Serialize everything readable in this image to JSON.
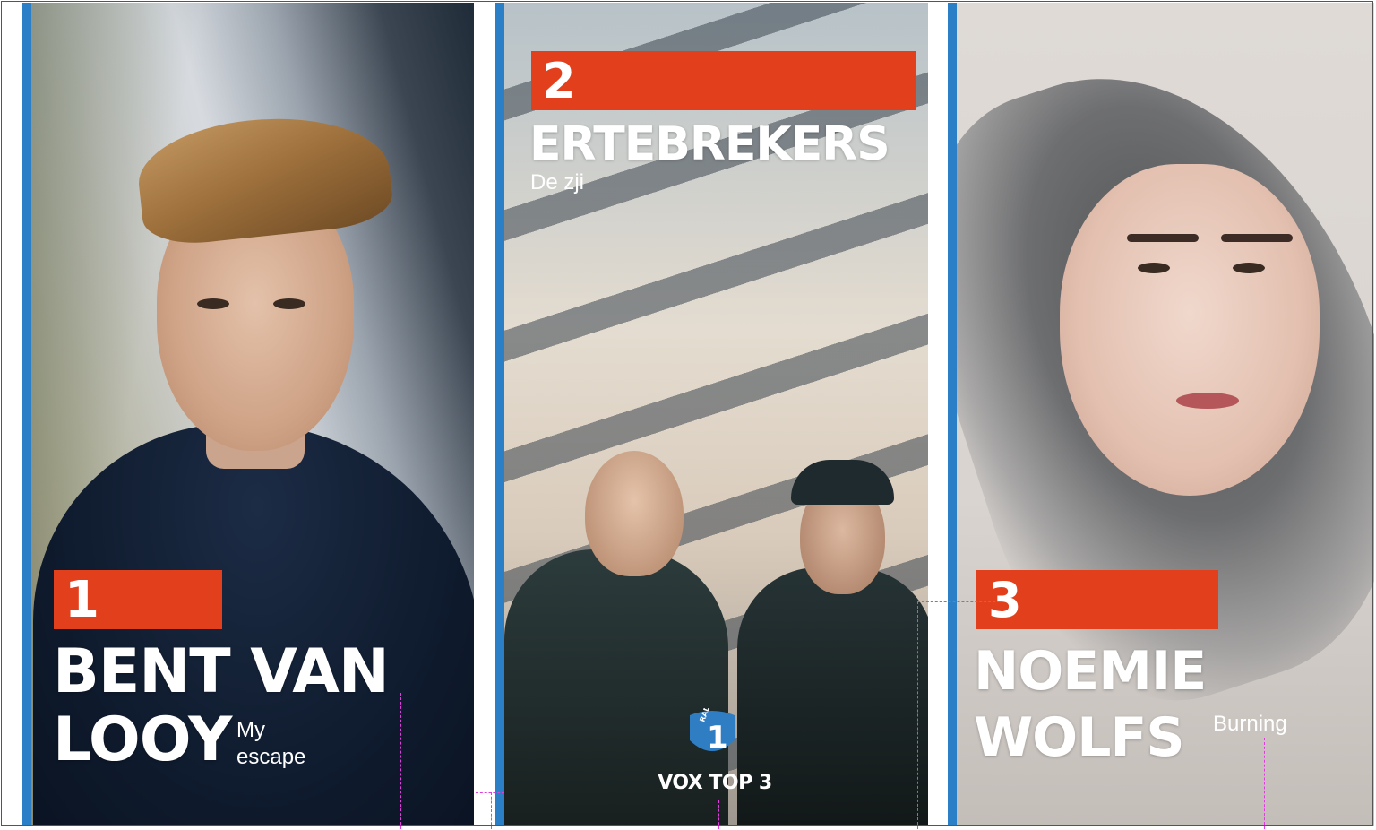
{
  "cards": [
    {
      "rank": "1",
      "artist_line1": "BENT VAN",
      "artist_line2": "LOOY",
      "song_line1": "My",
      "song_line2": "escape"
    },
    {
      "rank": "2",
      "artist": "ERTEBREKERS",
      "song": "De zji",
      "logo_text": "RADIO",
      "logo_number": "1",
      "caption": "VOX TOP 3"
    },
    {
      "rank": "3",
      "artist_line1": "NOEMIE",
      "artist_line2": "WOLFS",
      "song": "Burning"
    }
  ],
  "colors": {
    "accent_bar": "#2b7fc7",
    "rank_bar": "#e23f1d",
    "text": "#ffffff",
    "guides": "#e13ce0"
  }
}
